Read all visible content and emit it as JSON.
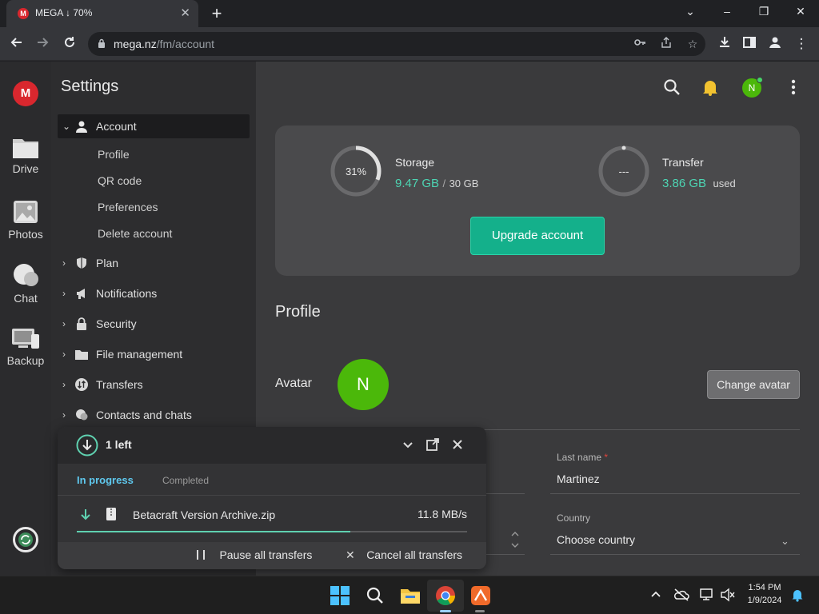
{
  "browser": {
    "tab_title": "MEGA ↓ 70%",
    "favicon_letter": "M",
    "url_host": "mega.nz",
    "url_path": "/fm/account"
  },
  "rail": {
    "logo": "M",
    "items": [
      {
        "label": "Drive",
        "icon": "folder-icon"
      },
      {
        "label": "Photos",
        "icon": "photo-icon"
      },
      {
        "label": "Chat",
        "icon": "chat-icon"
      },
      {
        "label": "Backup",
        "icon": "backup-icon"
      }
    ]
  },
  "sidebar": {
    "title": "Settings",
    "account_label": "Account",
    "sub_items": [
      "Profile",
      "QR code",
      "Preferences",
      "Delete account"
    ],
    "items": [
      {
        "label": "Plan",
        "icon": "shield-icon"
      },
      {
        "label": "Notifications",
        "icon": "megaphone-icon"
      },
      {
        "label": "Security",
        "icon": "lock-icon"
      },
      {
        "label": "File management",
        "icon": "folder-icon"
      },
      {
        "label": "Transfers",
        "icon": "transfer-icon"
      },
      {
        "label": "Contacts and chats",
        "icon": "chat-icon"
      }
    ]
  },
  "header": {
    "avatar_letter": "N"
  },
  "usage": {
    "storage_label": "Storage",
    "storage_percent_text": "31%",
    "storage_percent": 31,
    "storage_used": "9.47 GB",
    "storage_sep": "/",
    "storage_total": "30 GB",
    "transfer_label": "Transfer",
    "transfer_ring_text": "---",
    "transfer_used": "3.86 GB",
    "transfer_suffix": "used",
    "upgrade_label": "Upgrade account"
  },
  "profile": {
    "heading": "Profile",
    "avatar_label": "Avatar",
    "avatar_letter": "N",
    "change_avatar_label": "Change avatar",
    "last_name_label": "Last name",
    "required_mark": "*",
    "last_name_value": "Martinez",
    "country_label": "Country",
    "country_value": "Choose country"
  },
  "transfers_panel": {
    "count_label": "1 left",
    "tab_in_progress": "In progress",
    "tab_completed": "Completed",
    "file_name": "Betacraft Version Archive.zip",
    "speed": "11.8 MB/s",
    "progress": 0.7,
    "pause_label": "Pause all transfers",
    "cancel_label": "Cancel all transfers"
  },
  "taskbar": {
    "time": "1:54 PM",
    "date": "1/9/2024"
  },
  "colors": {
    "accent_green": "#14b08b",
    "mega_red": "#d9272e",
    "avatar_green": "#4bb80a",
    "value_teal": "#4dd5b3"
  }
}
